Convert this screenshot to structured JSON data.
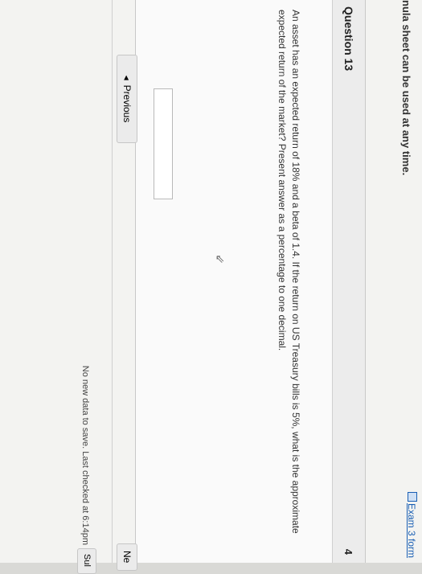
{
  "header": {
    "notice": "nula sheet can be used at any time.",
    "exam_link": "Exam 3 form"
  },
  "question": {
    "title": "Question 13",
    "points": "4",
    "text": "An asset has an expected return of 18% and a beta of 1.4. If the return on US Treasury bills is 5%, what is the approximate expected return of the market? Present answer as a percentage to one decimal.",
    "answer_value": ""
  },
  "nav": {
    "previous_label": "Previous",
    "next_label": "Ne"
  },
  "footer": {
    "status": "No new data to save. Last checked at 6:14pm",
    "submit_label": "Sul"
  }
}
